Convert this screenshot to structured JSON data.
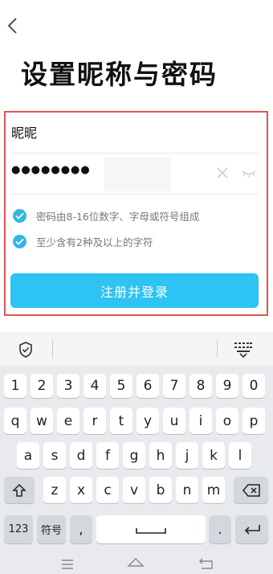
{
  "page_title": "设置昵称与密码",
  "form": {
    "nickname_value": "昵昵",
    "password_masked": "●●●●●●●●",
    "rules": [
      {
        "text": "密码由8-16位数字、字母或符号组成"
      },
      {
        "text": "至少含有2种及以上的字符"
      }
    ],
    "submit_label": "注册并登录"
  },
  "keyboard": {
    "number_row": [
      "1",
      "2",
      "3",
      "4",
      "5",
      "6",
      "7",
      "8",
      "9",
      "0"
    ],
    "row1": [
      "q",
      "w",
      "e",
      "r",
      "t",
      "y",
      "u",
      "i",
      "o",
      "p"
    ],
    "row2": [
      "a",
      "s",
      "d",
      "f",
      "g",
      "h",
      "j",
      "k",
      "l"
    ],
    "row3": [
      "z",
      "x",
      "c",
      "v",
      "b",
      "n",
      "m"
    ],
    "bottom": {
      "numbers": "123",
      "symbols": "符号",
      "comma": ",",
      "period": "."
    }
  },
  "colors": {
    "accent": "#2dc3f2",
    "check": "#31b8e6",
    "frame": "#e05353"
  },
  "icons": [
    "back-arrow-icon",
    "clear-icon",
    "eye-closed-icon",
    "check-circle-icon",
    "shield-icon",
    "keyboard-collapse-icon",
    "shift-icon",
    "backspace-icon",
    "space-icon",
    "enter-icon",
    "menu-icon",
    "home-icon",
    "back-icon"
  ]
}
